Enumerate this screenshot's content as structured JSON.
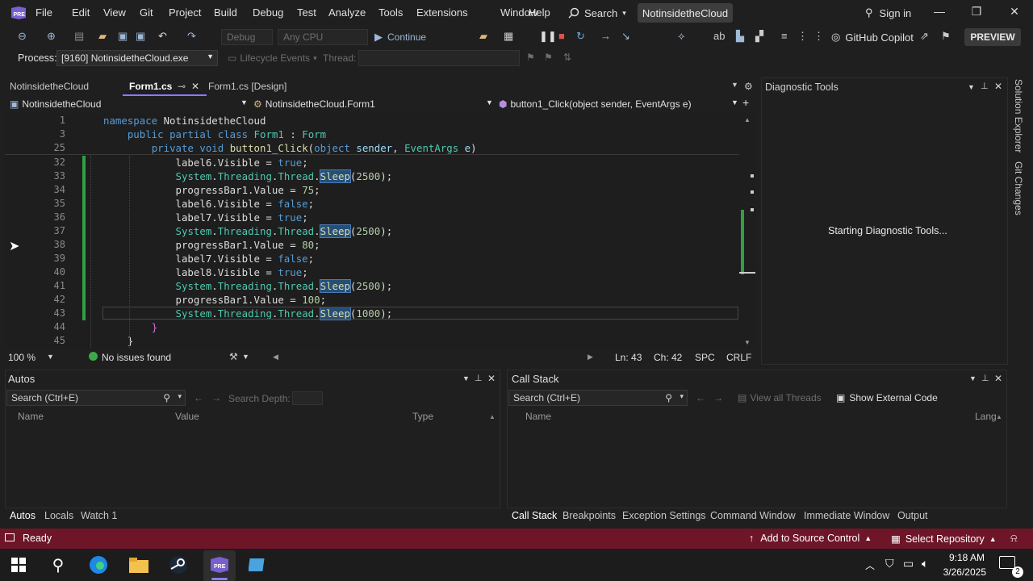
{
  "menu": [
    "File",
    "Edit",
    "View",
    "Git",
    "Project",
    "Build",
    "Debug",
    "Test",
    "Analyze",
    "Tools",
    "Extensions",
    "Window",
    "Help"
  ],
  "search_label": "Search",
  "solution_name": "NotinsidetheCloud",
  "signin": "Sign in",
  "toolbar": {
    "config": "Debug",
    "platform": "Any CPU",
    "continue": "Continue",
    "copilot": "GitHub Copilot",
    "preview": "PREVIEW"
  },
  "process": {
    "label": "Process:",
    "value": "[9160] NotinsidetheCloud.exe",
    "lifecycle": "Lifecycle Events",
    "thread": "Thread:"
  },
  "tabs": {
    "project": "NotinsidetheCloud",
    "active": "Form1.cs",
    "design": "Form1.cs [Design]"
  },
  "nav": {
    "project": "NotinsidetheCloud",
    "class": "NotinsidetheCloud.Form1",
    "member": "button1_Click(object sender, EventArgs e)"
  },
  "sticky": [
    {
      "ln": "1",
      "text": "namespace NotinsidetheCloud"
    },
    {
      "ln": "3",
      "text": "public partial class Form1 : Form"
    },
    {
      "ln": "25",
      "text": "private void button1_Click(object sender, EventArgs e)"
    }
  ],
  "code_lines": [
    {
      "ln": "32",
      "obj": "label6",
      "prop": "Visible",
      "val": "true",
      "kind": "bool"
    },
    {
      "ln": "33",
      "sleep": "2500"
    },
    {
      "ln": "34",
      "obj": "progressBar1",
      "prop": "Value",
      "val": "75",
      "kind": "num"
    },
    {
      "ln": "35",
      "obj": "label6",
      "prop": "Visible",
      "val": "false",
      "kind": "bool"
    },
    {
      "ln": "36",
      "obj": "label7",
      "prop": "Visible",
      "val": "true",
      "kind": "bool"
    },
    {
      "ln": "37",
      "sleep": "2500"
    },
    {
      "ln": "38",
      "obj": "progressBar1",
      "prop": "Value",
      "val": "80",
      "kind": "num"
    },
    {
      "ln": "39",
      "obj": "label7",
      "prop": "Visible",
      "val": "false",
      "kind": "bool"
    },
    {
      "ln": "40",
      "obj": "label8",
      "prop": "Visible",
      "val": "true",
      "kind": "bool"
    },
    {
      "ln": "41",
      "sleep": "2500"
    },
    {
      "ln": "42",
      "obj": "progressBar1",
      "prop": "Value",
      "val": "100",
      "kind": "num"
    },
    {
      "ln": "43",
      "sleep": "1000"
    },
    {
      "ln": "44",
      "brace": "}"
    },
    {
      "ln": "45",
      "brace": "}"
    }
  ],
  "editor_status": {
    "zoom": "100 %",
    "issues": "No issues found",
    "ln": "Ln: 43",
    "ch": "Ch: 42",
    "spc": "SPC",
    "crlf": "CRLF"
  },
  "diagnostic": {
    "title": "Diagnostic Tools",
    "message": "Starting Diagnostic Tools..."
  },
  "side_tabs": [
    "Solution Explorer",
    "Git Changes"
  ],
  "autos": {
    "title": "Autos",
    "search": "Search (Ctrl+E)",
    "depth": "Search Depth:",
    "cols": [
      "Name",
      "Value",
      "Type"
    ]
  },
  "callstack": {
    "title": "Call Stack",
    "search": "Search (Ctrl+E)",
    "view_threads": "View all Threads",
    "external": "Show External Code",
    "cols": [
      "Name",
      "Lang"
    ]
  },
  "left_tabs": [
    "Autos",
    "Locals",
    "Watch 1"
  ],
  "right_tabs": [
    "Call Stack",
    "Breakpoints",
    "Exception Settings",
    "Command Window",
    "Immediate Window",
    "Output"
  ],
  "status": {
    "ready": "Ready",
    "source_control": "Add to Source Control",
    "repo": "Select Repository"
  },
  "taskbar": {
    "time": "9:18 AM",
    "date": "3/26/2025",
    "notifications": "2"
  },
  "colors": {
    "accent": "#8a7cff",
    "status_bar": "#6e1528",
    "change_bar": "#2ea043"
  }
}
